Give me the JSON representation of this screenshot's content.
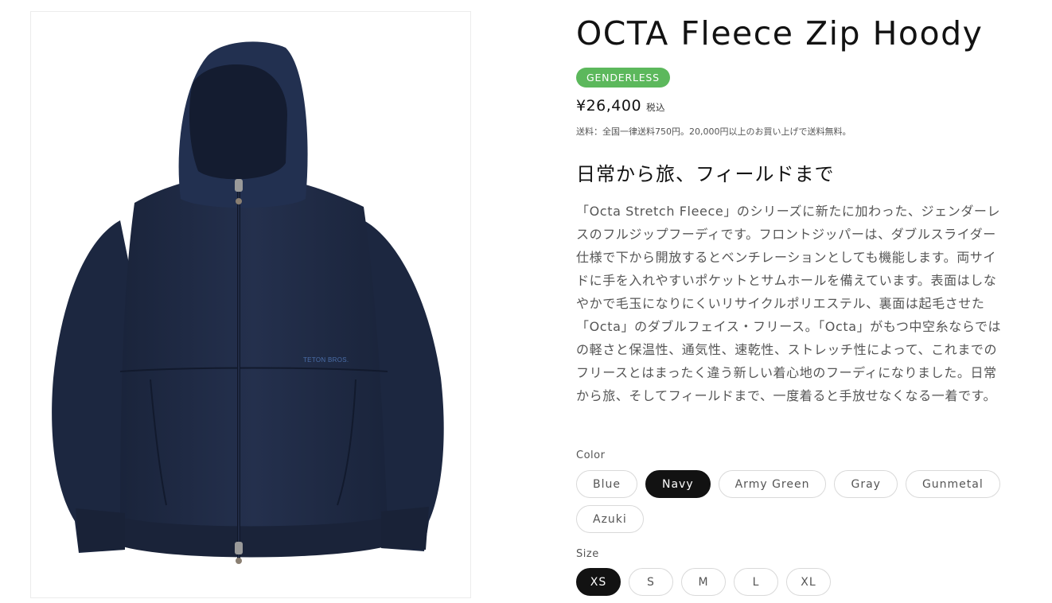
{
  "product": {
    "title": "OCTA Fleece Zip Hoody",
    "badge": "GENDERLESS",
    "price": "¥26,400",
    "tax_label": "税込",
    "shipping": "送料：全国一律送料750円。20,000円以上のお買い上げで送料無料。",
    "subheading": "日常から旅、フィールドまで",
    "description": "「Octa Stretch Fleece」のシリーズに新たに加わった、ジェンダーレスのフルジップフーディです。フロントジッパーは、ダブルスライダー仕様で下から開放するとベンチレーションとしても機能します。両サイドに手を入れやすいポケットとサムホールを備えています。表面はしなやかで毛玉になりにくいリサイクルポリエステル、裏面は起毛させた「Octa」のダブルフェイス・フリース。「Octa」がもつ中空糸ならではの軽さと保温性、通気性、速乾性、ストレッチ性によって、これまでのフリースとはまったく違う新しい着心地のフーディになりました。日常から旅、そしてフィールドまで、一度着ると手放せなくなる一着です。"
  },
  "image": {
    "logo_text": "TETON BROS."
  },
  "options": {
    "color_label": "Color",
    "colors": [
      "Blue",
      "Navy",
      "Army Green",
      "Gray",
      "Gunmetal",
      "Azuki"
    ],
    "selected_color": "Navy",
    "size_label": "Size",
    "sizes": [
      "XS",
      "S",
      "M",
      "L",
      "XL"
    ],
    "selected_size": "XS"
  },
  "colors": {
    "badge": "#5cb85c",
    "garment": "#1f2b45",
    "selected_pill": "#121212"
  }
}
